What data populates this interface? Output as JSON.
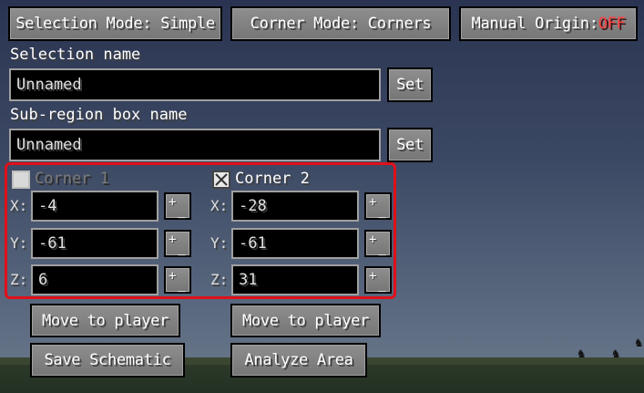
{
  "top": {
    "selection_mode": "Selection Mode: Simple",
    "corner_mode": "Corner Mode: Corners",
    "manual_origin_label": "Manual Origin: ",
    "manual_origin_value": "OFF"
  },
  "selection": {
    "name_label": "Selection name",
    "name_value": "Unnamed",
    "set_label": "Set"
  },
  "subregion": {
    "name_label": "Sub-region box name",
    "name_value": "Unnamed",
    "set_label": "Set"
  },
  "corner1": {
    "label": "Corner 1",
    "checked": false,
    "x": "-4",
    "y": "-61",
    "z": "6",
    "move_label": "Move to player"
  },
  "corner2": {
    "label": "Corner 2",
    "checked": true,
    "x": "-28",
    "y": "-61",
    "z": "31",
    "move_label": "Move to player"
  },
  "axes": {
    "x": "X:",
    "y": "Y:",
    "z": "Z:"
  },
  "pm_plus": "+",
  "pm_minus": "_",
  "actions": {
    "save_schematic": "Save Schematic",
    "analyze_area": "Analyze Area"
  },
  "colors": {
    "highlight": "#e0101a",
    "off": "#ff4040"
  }
}
